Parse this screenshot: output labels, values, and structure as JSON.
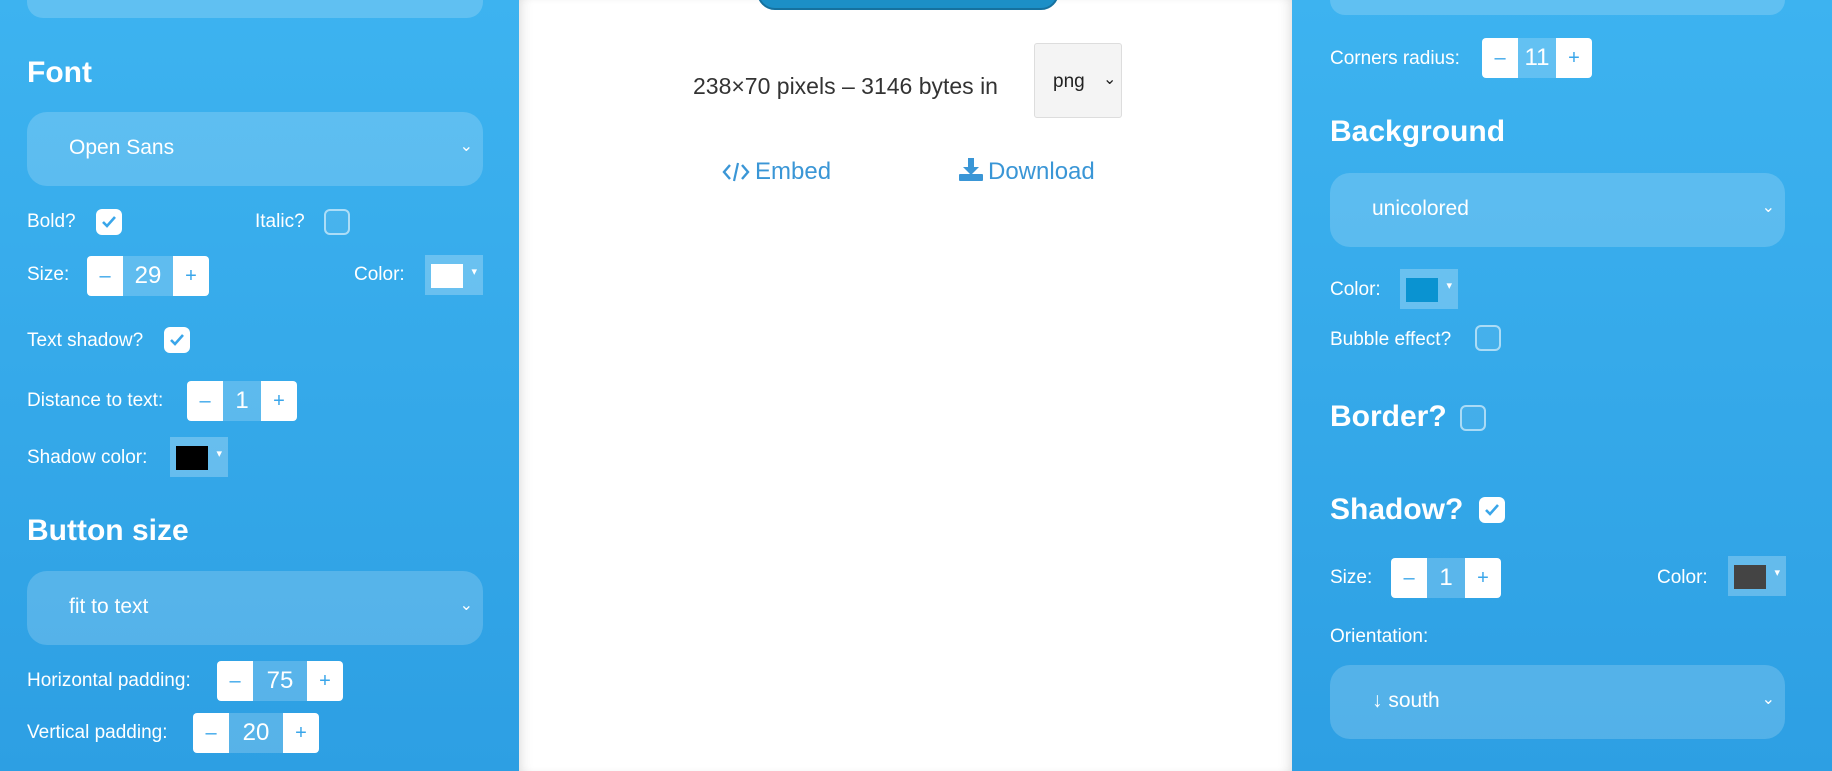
{
  "left": {
    "font_heading": "Font",
    "font_select": "Open Sans",
    "bold_label": "Bold?",
    "bold_checked": true,
    "italic_label": "Italic?",
    "italic_checked": false,
    "size_label": "Size:",
    "size_value": "29",
    "color_label": "Color:",
    "text_color": "#ffffff",
    "text_shadow_label": "Text shadow?",
    "text_shadow_checked": true,
    "distance_label": "Distance to text:",
    "distance_value": "1",
    "shadow_color_label": "Shadow color:",
    "shadow_color": "#000000",
    "button_size_heading": "Button size",
    "button_size_select": "fit to text",
    "hpad_label": "Horizontal padding:",
    "hpad_value": "75",
    "vpad_label": "Vertical padding:",
    "vpad_value": "20"
  },
  "center": {
    "info_text": "238×70 pixels – 3146 bytes in",
    "format_select": "png",
    "embed_label": "Embed",
    "download_label": "Download",
    "preview_color": "#1c8fc7"
  },
  "right": {
    "corners_label": "Corners radius:",
    "corners_value": "11",
    "background_heading": "Background",
    "background_select": "unicolored",
    "bg_color_label": "Color:",
    "bg_color": "#0a93d1",
    "bubble_label": "Bubble effect?",
    "bubble_checked": false,
    "border_heading": "Border?",
    "border_checked": false,
    "shadow_heading": "Shadow?",
    "shadow_checked": true,
    "shadow_size_label": "Size:",
    "shadow_size_value": "1",
    "shadow_color_label": "Color:",
    "shadow_color": "#444444",
    "orientation_label": "Orientation:",
    "orientation_select": "↓ south"
  },
  "icons": {
    "minus": "–",
    "plus": "+",
    "chevron": "⌄",
    "caret": "▾"
  }
}
